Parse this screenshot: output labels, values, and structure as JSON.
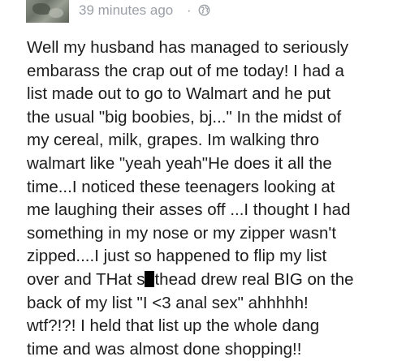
{
  "post": {
    "timestamp": "39 minutes ago",
    "separator": "·",
    "privacy_icon": "globe-icon",
    "lines": [
      "Well my husband has managed to seriously",
      "embarass the crap out of me today!  I had a",
      "list made out to go to Walmart and he put",
      "the usual \"big boobies, bj...\" In the midst of",
      "my cereal, milk, grapes.  Im walking thro",
      "walmart like \"yeah yeah\"He does it all the",
      "time...I noticed these teenagers looking at",
      "me laughing their asses off ...I thought I had",
      "something in my nose or my zipper wasn't",
      "zipped....I just so happened to flip my list"
    ],
    "censored_line": {
      "before": "over and THat s",
      "after": "thead drew real BIG on the"
    },
    "lines_after": [
      "back of my list  \"I <3 anal sex\" ahhhhh!",
      "wtf?!?!  I held that list up the whole dang",
      "time and was almost done shopping!!"
    ]
  },
  "colors": {
    "text": "#1c1c1c",
    "meta": "#9a9ea6",
    "background": "#ffffff"
  }
}
